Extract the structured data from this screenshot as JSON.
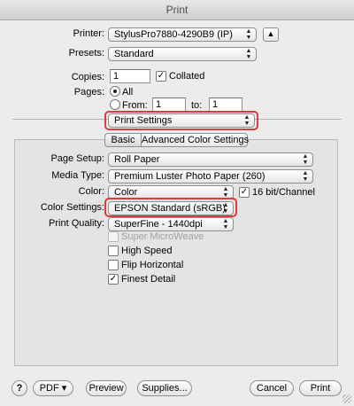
{
  "window": {
    "title": "Print"
  },
  "printer": {
    "label": "Printer:",
    "value": "StylusPro7880-4290B9 (IP)"
  },
  "presets": {
    "label": "Presets:",
    "value": "Standard"
  },
  "copies": {
    "label": "Copies:",
    "value": "1",
    "collated_label": "Collated",
    "collated": true
  },
  "pages": {
    "label": "Pages:",
    "all_label": "All",
    "from_label": "From:",
    "from_value": "1",
    "to_label": "to:",
    "to_value": "1",
    "selected": "All"
  },
  "section": {
    "value": "Print Settings"
  },
  "tabs": [
    {
      "label": "Basic",
      "selected": true
    },
    {
      "label": "Advanced Color Settings",
      "selected": false
    }
  ],
  "settings": {
    "page_setup": {
      "label": "Page Setup:",
      "value": "Roll Paper"
    },
    "media_type": {
      "label": "Media Type:",
      "value": "Premium Luster Photo Paper (260)"
    },
    "color": {
      "label": "Color:",
      "value": "Color",
      "bit16_label": "16 bit/Channel",
      "bit16": true
    },
    "color_settings": {
      "label": "Color Settings:",
      "value": "EPSON Standard (sRGB)"
    },
    "print_quality": {
      "label": "Print Quality:",
      "value": "SuperFine - 1440dpi"
    }
  },
  "options": [
    {
      "label": "Super MicroWeave",
      "checked": false,
      "enabled": false
    },
    {
      "label": "High Speed",
      "checked": false,
      "enabled": true
    },
    {
      "label": "Flip Horizontal",
      "checked": false,
      "enabled": true
    },
    {
      "label": "Finest Detail",
      "checked": true,
      "enabled": true
    }
  ],
  "footer": {
    "help": "?",
    "pdf": "PDF ▾",
    "preview": "Preview",
    "supplies": "Supplies...",
    "cancel": "Cancel",
    "print": "Print"
  },
  "icons": {
    "check": "✓",
    "arrow_up": "▲",
    "arrow_down": "▼",
    "disclosure": "▲"
  },
  "colors": {
    "highlight": "#d83c3c"
  }
}
